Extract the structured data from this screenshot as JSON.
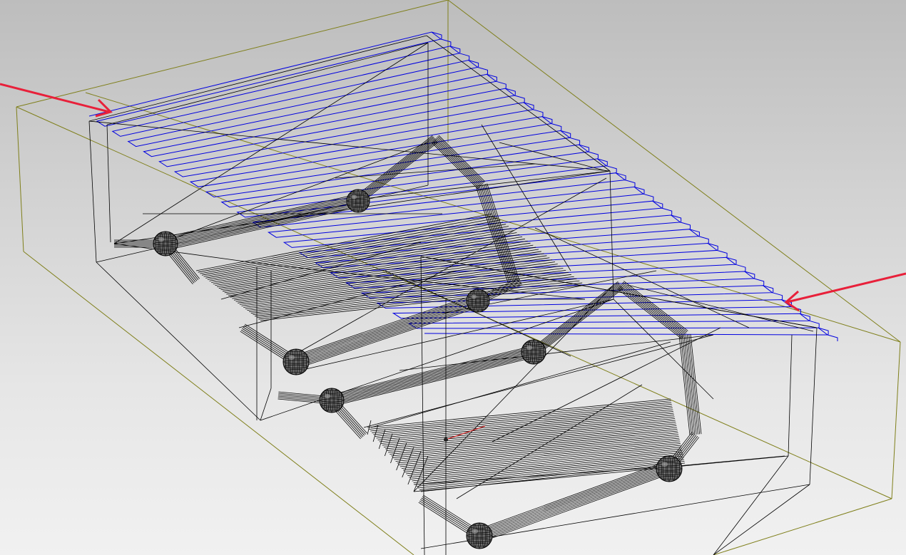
{
  "viewport": {
    "type": "3d-wireframe-cad-view",
    "background": "light-gray-gradient"
  },
  "colors": {
    "stock_box": "#7f7f1a",
    "toolpath": "#0000e0",
    "part_wireframe": "#000000",
    "annotation_arrow": "#e8203a",
    "axis_marker": "#d01010"
  },
  "scene": {
    "stock_box": "stock-bounding-box",
    "toolpath": "zigzag-raster-toolpath",
    "part": "wireframe-machined-part",
    "annotation_count": 2
  },
  "annotations": [
    {
      "name": "annotation-arrow-left",
      "points_to": "toolpath-start"
    },
    {
      "name": "annotation-arrow-right",
      "points_to": "toolpath-end"
    }
  ],
  "icons": [
    "arrow-icon",
    "sphere-node-icon",
    "axis-marker-icon"
  ]
}
